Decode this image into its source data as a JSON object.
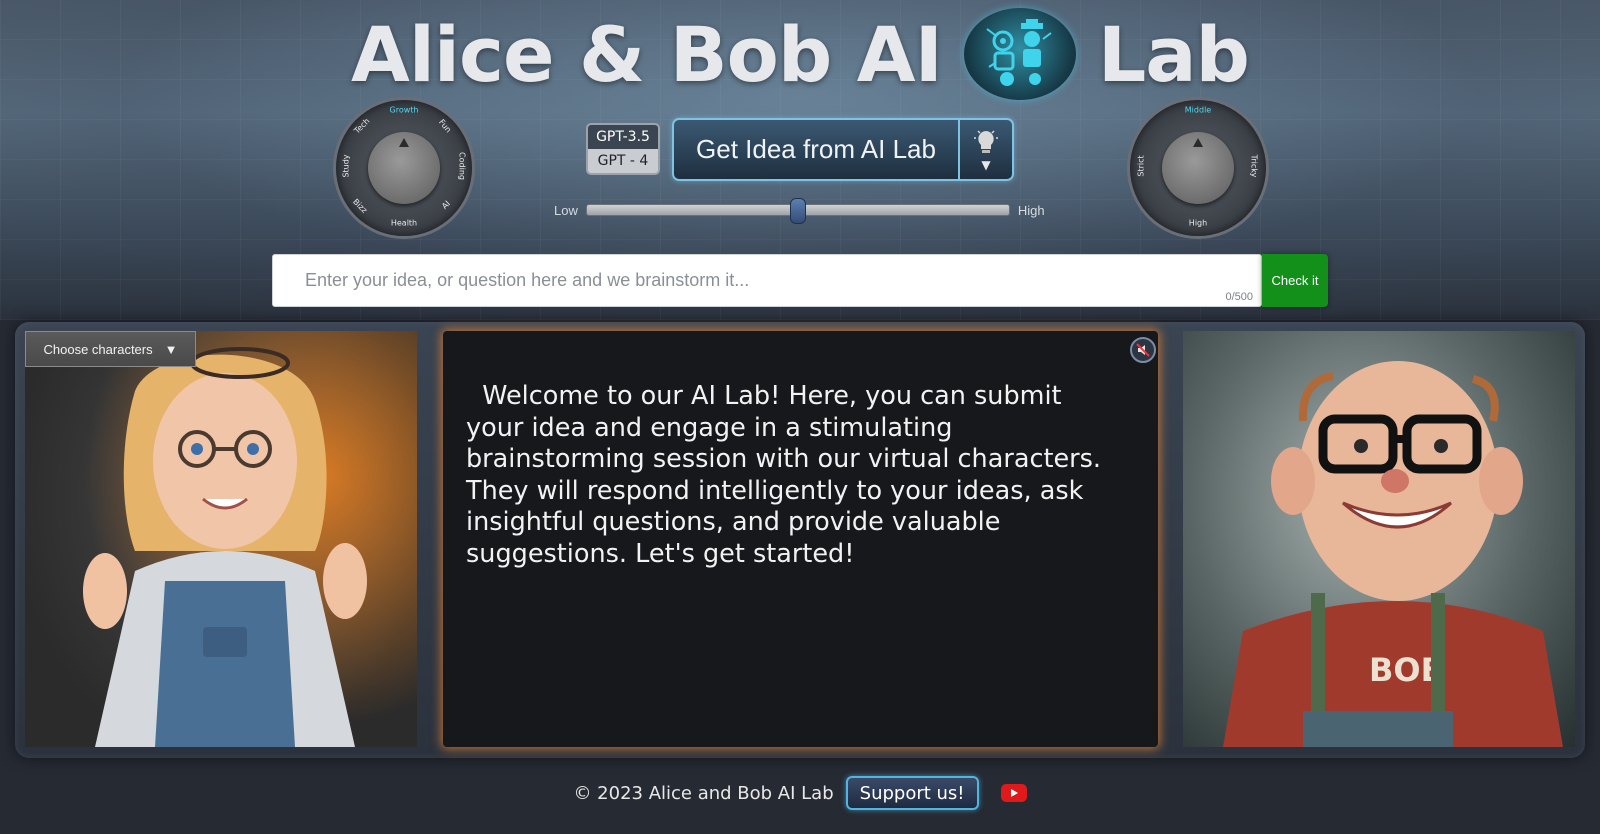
{
  "header": {
    "title_left": "Alice & Bob AI",
    "title_right": "Lab",
    "logo_icon": "robot-lab-logo"
  },
  "topic_dial": {
    "labels": [
      "Growth",
      "Fun",
      "Coding",
      "AI",
      "Health",
      "Bizz",
      "Study",
      "Tech"
    ],
    "selected": "Growth"
  },
  "difficulty_dial": {
    "labels": [
      "Middle",
      "Tricky",
      "High",
      "Strict"
    ],
    "selected": "Middle"
  },
  "model_toggle": {
    "options": [
      "GPT-3.5",
      "GPT - 4"
    ],
    "selected": "GPT-3.5"
  },
  "idea_button": {
    "label": "Get Idea from AI Lab",
    "icon": "lightbulb-icon"
  },
  "creativity_slider": {
    "min_label": "Low",
    "max_label": "High",
    "value": 0.5
  },
  "idea_input": {
    "placeholder": "Enter your idea, or question here and we brainstorm it...",
    "value": "",
    "counter": "0/500"
  },
  "check_button": {
    "label": "Check it"
  },
  "character_select": {
    "label": "Choose characters",
    "arrow": "▼"
  },
  "chat": {
    "message": "  Welcome to our AI Lab! Here, you can submit your idea and engage in a stimulating brainstorming session with our virtual characters. They will respond intelligently to your ideas, ask insightful questions, and provide valuable suggestions. Let's get started!"
  },
  "footer": {
    "copyright": "© 2023 Alice and Bob AI Lab",
    "support_label": "Support us!"
  },
  "colors": {
    "accent_cyan": "#4fd8f0",
    "check_green": "#13901a",
    "chat_glow": "#e6822f",
    "youtube_red": "#e01a1a"
  }
}
